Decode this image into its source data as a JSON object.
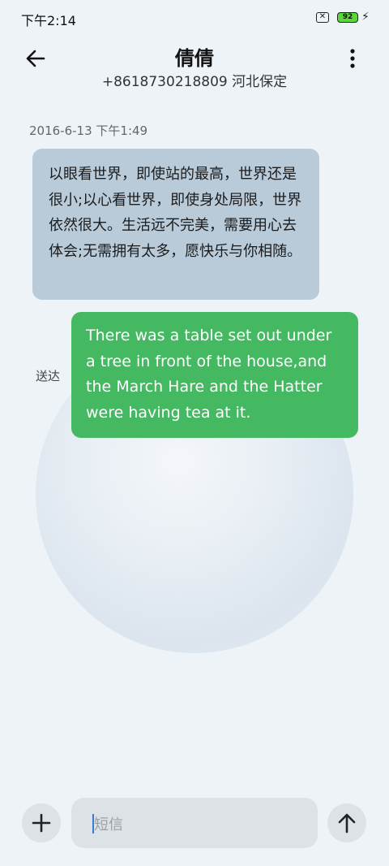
{
  "status_bar": {
    "time": "下午2:14",
    "sim_icon": "sim-off-icon",
    "battery_level": "92",
    "charging_icon": "bolt-icon"
  },
  "header": {
    "contact_name": "倩倩",
    "contact_subtitle": "+8618730218809 河北保定",
    "back_icon": "arrow-left-icon",
    "menu_icon": "more-vertical-icon"
  },
  "conversation": {
    "timestamp": "2016-6-13 下午1:49",
    "incoming_message": "以眼看世界，即使站的最高，世界还是很小;以心看世界，即使身处局限，世界依然很大。生活远不完美，需要用心去体会;无需拥有太多，愿快乐与你相随。",
    "outgoing_message": "There was a table set out under a tree in front of the house,and the March Hare and the Hatter were having tea at it.",
    "delivery_status": "送达"
  },
  "composer": {
    "placeholder": "短信",
    "add_icon": "plus-icon",
    "send_icon": "arrow-up-icon"
  },
  "colors": {
    "background": "#eef3f8",
    "incoming_bubble": "#b9cad8",
    "outgoing_bubble": "#45b862",
    "battery": "#5bd73a"
  }
}
